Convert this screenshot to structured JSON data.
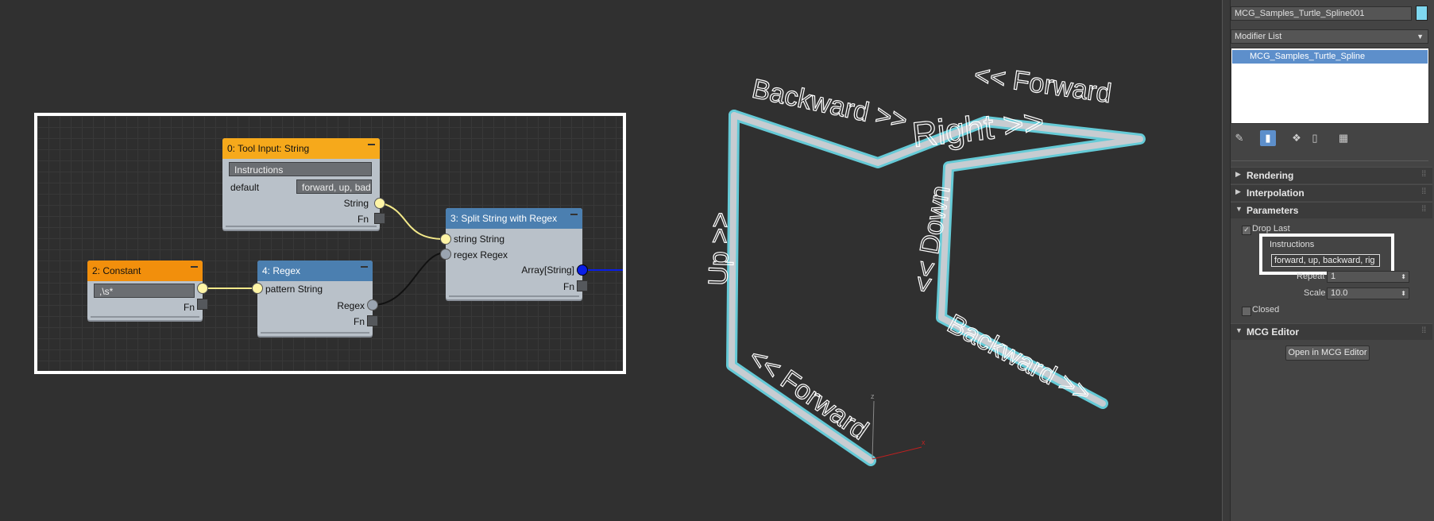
{
  "graph": {
    "node0": {
      "title": "0: Tool Input: String",
      "name_value": "Instructions",
      "default_label": "default",
      "default_value": "forward, up, bad",
      "out_label": "String",
      "fn_label": "Fn"
    },
    "node2": {
      "title": "2: Constant",
      "value": ",\\s*",
      "fn_label": "Fn"
    },
    "node4": {
      "title": "4: Regex",
      "in_label": "pattern String",
      "out_label": "Regex",
      "fn_label": "Fn"
    },
    "node3": {
      "title": "3: Split String with Regex",
      "in1_label": "string String",
      "in2_label": "regex Regex",
      "out_label": "Array[String]",
      "fn_label": "Fn"
    }
  },
  "viewport": {
    "labels": [
      "Backward >>",
      "<< Forward",
      "Right >>",
      "<< Down",
      "Up >>",
      "Backward >>",
      "<< Forward"
    ],
    "axis_x": "x",
    "axis_z": "z"
  },
  "panel": {
    "object_name": "MCG_Samples_Turtle_Spline001",
    "swatch_color": "#7fd8f0",
    "modifier_list_label": "Modifier List",
    "stack_item": "MCG_Samples_Turtle_Spline",
    "rollouts": {
      "rendering": "Rendering",
      "interpolation": "Interpolation",
      "parameters": "Parameters",
      "mcg_editor": "MCG Editor"
    },
    "drop_last_label": "Drop Last",
    "instructions_label": "Instructions",
    "instructions_value": "forward, up, backward, rig",
    "repeat_label": "Repeat",
    "repeat_value": "1",
    "scale_label": "Scale",
    "scale_value": "10.0",
    "closed_label": "Closed",
    "open_button": "Open in MCG Editor"
  }
}
